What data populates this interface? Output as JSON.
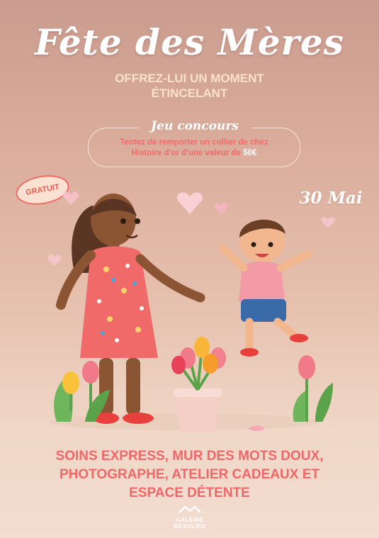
{
  "poster": {
    "title": "Fête des Mères",
    "subtitle_line1": "OFFREZ-LUI UN MOMENT",
    "subtitle_line2": "ÉTINCELANT",
    "contest": {
      "title": "Jeu concours",
      "line1": "Tentez de remporter un collier de chez",
      "line2_prefix": "Histoire d'or d'une valeur de ",
      "price": "50€"
    },
    "badge": "GRATUIT",
    "date": "30 Mai",
    "activities": {
      "line1": "SOINS EXPRESS, MUR DES MOTS DOUX,",
      "line2": "PHOTOGRAPHE, ATELIER CADEAUX ET",
      "line3": "ESPACE DÉTENTE"
    },
    "logo": {
      "line1": "GALERIE",
      "line2": "BEAULIEU",
      "icon": "mountain-roof-icon"
    }
  },
  "colors": {
    "accent": "#f0676a",
    "title": "#ffffff",
    "subtitle": "#fbe2c8"
  }
}
